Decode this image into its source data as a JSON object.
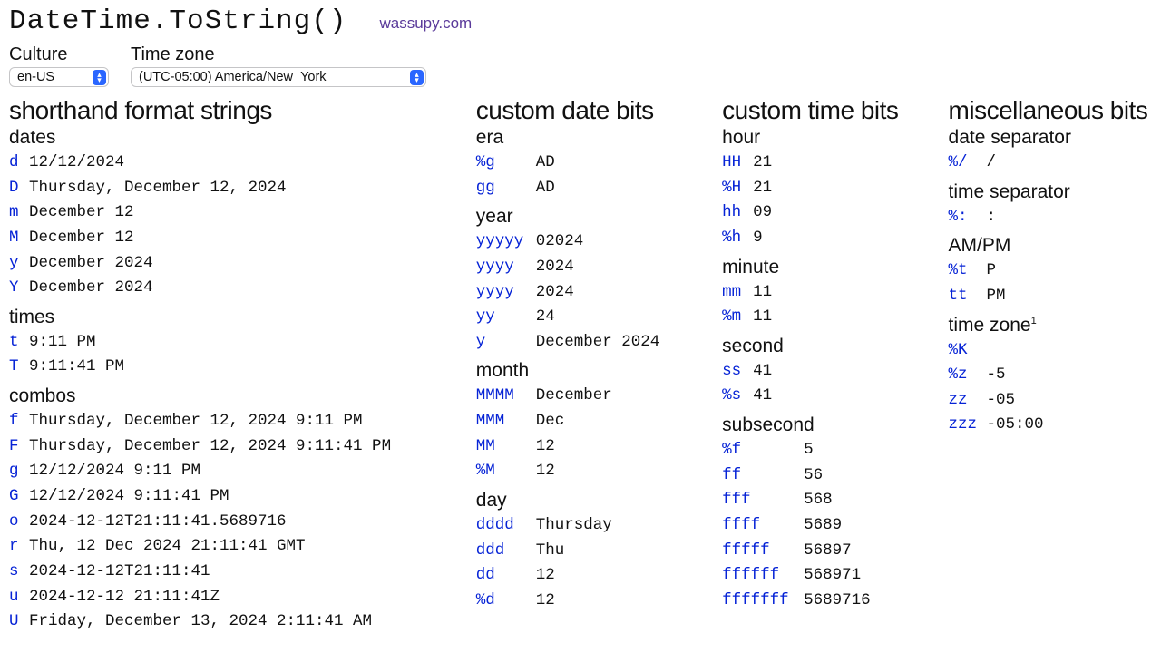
{
  "header": {
    "title": "DateTime.ToString()",
    "link": "wassupy.com"
  },
  "controls": {
    "culture_label": "Culture",
    "culture_value": "en-US",
    "timezone_label": "Time zone",
    "timezone_value": "(UTC-05:00) America/New_York"
  },
  "col1": {
    "heading": "shorthand format strings",
    "dates_label": "dates",
    "dates": [
      {
        "c": "d",
        "v": "12/12/2024"
      },
      {
        "c": "D",
        "v": "Thursday, December 12, 2024"
      },
      {
        "c": "m",
        "v": "December 12"
      },
      {
        "c": "M",
        "v": "December 12"
      },
      {
        "c": "y",
        "v": "December 2024"
      },
      {
        "c": "Y",
        "v": "December 2024"
      }
    ],
    "times_label": "times",
    "times": [
      {
        "c": "t",
        "v": "9:11 PM"
      },
      {
        "c": "T",
        "v": "9:11:41 PM"
      }
    ],
    "combos_label": "combos",
    "combos": [
      {
        "c": "f",
        "v": "Thursday, December 12, 2024 9:11 PM"
      },
      {
        "c": "F",
        "v": "Thursday, December 12, 2024 9:11:41 PM"
      },
      {
        "c": "g",
        "v": "12/12/2024 9:11 PM"
      },
      {
        "c": "G",
        "v": "12/12/2024 9:11:41 PM"
      },
      {
        "c": "o",
        "v": "2024-12-12T21:11:41.5689716"
      },
      {
        "c": "r",
        "v": "Thu, 12 Dec 2024 21:11:41 GMT"
      },
      {
        "c": "s",
        "v": "2024-12-12T21:11:41"
      },
      {
        "c": "u",
        "v": "2024-12-12 21:11:41Z"
      },
      {
        "c": "U",
        "v": "Friday, December 13, 2024 2:11:41 AM"
      }
    ]
  },
  "col2": {
    "heading": "custom date bits",
    "era_label": "era",
    "era": [
      {
        "c": "%g",
        "v": "AD"
      },
      {
        "c": "gg",
        "v": "AD"
      }
    ],
    "year_label": "year",
    "year": [
      {
        "c": "yyyyy",
        "v": "02024"
      },
      {
        "c": "yyyy",
        "v": "2024"
      },
      {
        "c": "yyyy",
        "v": "2024"
      },
      {
        "c": "yy",
        "v": "24"
      },
      {
        "c": "y",
        "v": "December 2024"
      }
    ],
    "month_label": "month",
    "month": [
      {
        "c": "MMMM",
        "v": "December"
      },
      {
        "c": "MMM",
        "v": "Dec"
      },
      {
        "c": "MM",
        "v": "12"
      },
      {
        "c": "%M",
        "v": "12"
      }
    ],
    "day_label": "day",
    "day": [
      {
        "c": "dddd",
        "v": "Thursday"
      },
      {
        "c": "ddd",
        "v": "Thu"
      },
      {
        "c": "dd",
        "v": "12"
      },
      {
        "c": "%d",
        "v": "12"
      }
    ]
  },
  "col3": {
    "heading": "custom time bits",
    "hour_label": "hour",
    "hour": [
      {
        "c": "HH",
        "v": "21"
      },
      {
        "c": "%H",
        "v": "21"
      },
      {
        "c": "hh",
        "v": "09"
      },
      {
        "c": "%h",
        "v": "9"
      }
    ],
    "minute_label": "minute",
    "minute": [
      {
        "c": "mm",
        "v": "11"
      },
      {
        "c": "%m",
        "v": "11"
      }
    ],
    "second_label": "second",
    "second": [
      {
        "c": "ss",
        "v": "41"
      },
      {
        "c": "%s",
        "v": "41"
      }
    ],
    "subsecond_label": "subsecond",
    "subsecond": [
      {
        "c": "%f",
        "v": "5"
      },
      {
        "c": "ff",
        "v": "56"
      },
      {
        "c": "fff",
        "v": "568"
      },
      {
        "c": "ffff",
        "v": "5689"
      },
      {
        "c": "fffff",
        "v": "56897"
      },
      {
        "c": "ffffff",
        "v": "568971"
      },
      {
        "c": "fffffff",
        "v": "5689716"
      }
    ]
  },
  "col4": {
    "heading": "miscellaneous bits",
    "datesep_label": "date separator",
    "datesep": [
      {
        "c": "%/",
        "v": "/"
      }
    ],
    "timesep_label": "time separator",
    "timesep": [
      {
        "c": "%:",
        "v": ":"
      }
    ],
    "ampm_label": "AM/PM",
    "ampm": [
      {
        "c": "%t",
        "v": "P"
      },
      {
        "c": "tt",
        "v": "PM"
      }
    ],
    "tz_label": "time zone",
    "tz_sup": "1",
    "tz": [
      {
        "c": "%K",
        "v": ""
      },
      {
        "c": "%z",
        "v": "-5"
      },
      {
        "c": "zz",
        "v": "-05"
      },
      {
        "c": "zzz",
        "v": "-05:00"
      }
    ]
  }
}
